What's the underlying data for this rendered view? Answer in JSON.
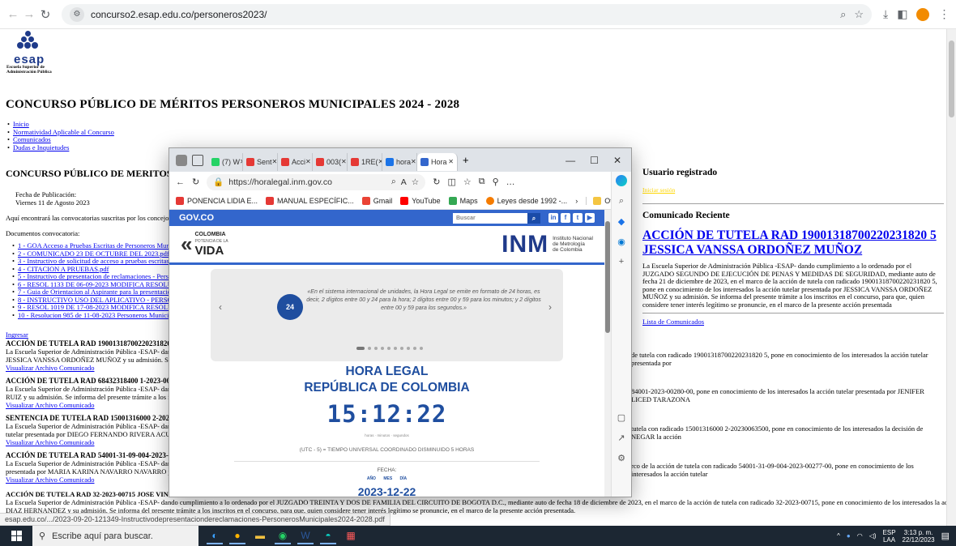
{
  "chrome": {
    "url": "concurso2.esap.edu.co/personeros2023/"
  },
  "logo": {
    "mark": "esap",
    "subtitle_1": "Escuela Superior de",
    "subtitle_2": "Administración Pública"
  },
  "page": {
    "title": "CONCURSO PÚBLICO DE MÉRITOS PERSONEROS MUNICIPALES 2024 - 2028",
    "nav": [
      "Inicio",
      "Normatividad Aplicable al Concurso",
      "Comunicados",
      "Dudas e Inquietudes"
    ]
  },
  "left": {
    "heading": "CONCURSO PÚBLICO DE MERITOS PE",
    "fecha_label": "Fecha de Publicación:",
    "fecha_value": "Viernes 11 de Agosto 2023",
    "intro": "Aquí encontrará las convocatorias suscritas por los concejos munici",
    "docs_label": "Documentos convocatoria:",
    "docs": [
      "1 - GOA Acceso a Pruebas Escritas de Personeros Municipale",
      "2 - COMUNICADO 23 DE OCTUBRE DEL 2023.pdf",
      "3 - Instructivo de solicitud de acceso a pruebas escritas - Perso",
      "4 - CITACION A PRUEBAS.pdf",
      "5 - Instructivo de presentacion de reclamaciones - Personeros",
      "6 - RESOL 1133 DE 06-09-2023 MODIFICA RESOLUCION",
      "7 - Guia de Orientacion al Aspirante para la presentacion de P",
      "8 - INSTRUCTIVO USO DEL APLICATIVO - PERSONERC",
      "9 - RESOL 1019 DE 17-08-2023 MODIFICA RESOLUCION",
      "10 - Resolucion 985 de 11-08-2023 Personeros Municipales.p"
    ],
    "ingresar": "Ingresar"
  },
  "right": {
    "user_heading": "Usuario registrado",
    "user_link": "Iniciar sesión",
    "comunicado_heading": "Comunicado Reciente",
    "big_link_1": "ACCIÓN DE TUTELA RAD 1900131870022023182O5",
    "big_link": "ACCIÓN DE TUTELA RAD 19001318700220231820 5",
    "text": "La Escuela Superior de Administración Pública -ESAP- dando cumplimiento a lo ordenado por el JUZGADO SEGUNDO DE EJECUCIÓN DE PENAS Y MEDIDAS DE SEGURIDAD, mediante auto de fecha 21 de diciembre de 2023, en el marco de la acción de tutela con radicado 19001318700220231820 5, pone en conocimiento de los interesados la acción tutelar presentada por JESSICA VANSSA ORDOÑEZ MUÑOZ y su admisión. Se informa del presente trámite a los inscritos en el concurso, para que, quien considere tener interés legítimo se pronuncie, en el marco de la presente acción presentada",
    "lista": "Lista de Comunicados"
  },
  "items": [
    {
      "title": "ACCIÓN DE TUTELA RAD 19001318700220231820 5 JESSICA",
      "left_text": "La Escuela Superior de Administración Pública -ESAP- dando cump",
      "left_text2": "JESSICA VANSSA ORDOÑEZ MUÑOZ y su admisión. Se informa",
      "link": "Visualizar Archivo Comunicado",
      "right_text": "de tutela con radicado 19001318700220231820 5, pone en conocimiento de los interesados la acción tutelar presentada por"
    },
    {
      "title": "ACCIÓN DE TUTELA RAD 68432318400 1-2023-00280-00 JEN",
      "left_text": "La Escuela Superior de Administración Pública -ESAP- dando cump",
      "left_text2": "RUIZ y su admisión. Se informa del presente trámite a los inscritos e",
      "link": "Visualizar Archivo Comunicado",
      "right_text": "84001-2023-00280-00, pone en conocimiento de los interesados la acción tutelar presentada por JENIFER LICED TARAZONA"
    },
    {
      "title": "SENTENCIA DE TUTELA RAD 15001316000 2-202300635000 D",
      "left_text": "La Escuela Superior de Administración Pública -ESAP- dando cump",
      "left_text2": "tutelar presentada por DIEGO FERNANDO RIVERA ACUÑA.",
      "link": "Visualizar Archivo Comunicado",
      "right_text": "tutela con radicado 15001316000 2-20230063500, pone en conocimiento de los interesados la decisión de NEGAR la acción"
    },
    {
      "title": "ACCIÓN DE TUTELA RAD 54001-31-09-004-2023-00277-00 M",
      "left_text": "La Escuela Superior de Administración Pública -ESAP- dando cump",
      "left_text2": "presentada por MARIA KARINA NAVARRO NAVARRO y su admi",
      "link": "Visualizar Archivo Comunicado",
      "right_text": "rco de la acción de tutela con radicado 54001-31-09-004-2023-00277-00, pone en conocimiento de los interesados la acción tutelar"
    }
  ],
  "last_item": {
    "title": "ACCIÓN DE TUTELA RAD 32-2023-00715 JOSE VINCENTE",
    "text_1": "La Escuela Superior de Administración Pública -ESAP- dando cumplimiento a lo ordenado por el JUZGADO TREINTA Y DOS DE FAMILIA DEL CIRCUITO DE BOGOTA D.C., mediante auto de fecha 18 de diciembre de 2023, en el marco de la acción de tutela con radicado 32-2023-00715, pone en conocimiento de los interesados la acción tutelar presentada por JOSE VINCENTE",
    "text_2": "DIAZ HERNANDEZ y su admisión. Se informa del presente trámite a los inscritos en el concurso, para que, quien considere tener interés legítimo se pronuncie, en el marco de la presente acción presentada."
  },
  "status_link": "esap.edu.co/.../2023-09-20-121349-Instructivodepresentaciondereclamaciones-PersonerosMunicipales2024-2028.pdf",
  "edge": {
    "tabs": [
      "(7) W",
      "Sent",
      "Acci",
      "003(",
      "1RE(",
      "hora",
      "Hora"
    ],
    "url": "https://horalegal.inm.gov.co",
    "favorites": [
      "PONENCIA LIDIA E...",
      "MANUAL ESPECÍFIC...",
      "Gmail",
      "YouTube",
      "Maps",
      "Leyes desde 1992 -..."
    ],
    "otros": "Otros favoritos",
    "gov": "GOV.CO",
    "search_placeholder": "Buscar",
    "colombia_1": "COLOMBIA",
    "colombia_2": "POTENCIA DE LA",
    "colombia_3": "VIDA",
    "inm_big": "INM",
    "inm_1": "Instituto Nacional",
    "inm_2": "de Metrología",
    "inm_3": "de Colombia",
    "carousel_text": "«En el sistema internacional de unidades, la Hora Legal se emite en formato de 24 horas, es decir, 2 dígitos entre 00 y 24 para la hora; 2 dígitos entre 00 y 59 para los minutos; y 2 dígitos entre 00 y 59 para los segundos.»",
    "carousel_icon": "24",
    "hora_1": "HORA LEGAL",
    "hora_2": "REPÚBLICA DE COLOMBIA",
    "clock": "15:12:22",
    "clock_sub": "horas · minutos · segundos",
    "utc": "(UTC - 5) = TIEMPO UNIVERSAL COORDINADO DISMINUIDO 5 HORAS",
    "fecha": "FECHA:",
    "ymd": "AÑO MES DÍA",
    "date": "2023-12-22"
  },
  "taskbar": {
    "search": "Escribe aquí para buscar.",
    "lang_1": "ESP",
    "lang_2": "LAA",
    "time": "3:13 p. m.",
    "date": "22/12/2023"
  }
}
